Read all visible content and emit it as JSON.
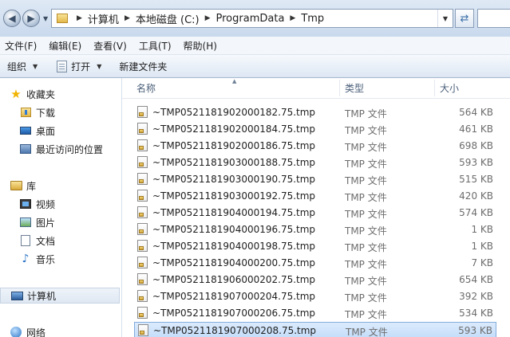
{
  "address": {
    "crumbs": [
      "计算机",
      "本地磁盘 (C:)",
      "ProgramData",
      "Tmp"
    ]
  },
  "menu": [
    "文件(F)",
    "编辑(E)",
    "查看(V)",
    "工具(T)",
    "帮助(H)"
  ],
  "commands": {
    "organize": "组织",
    "open": "打开",
    "new_folder": "新建文件夹"
  },
  "nav": {
    "favorites": "收藏夹",
    "downloads": "下载",
    "desktop": "桌面",
    "recent": "最近访问的位置",
    "libraries": "库",
    "videos": "视频",
    "pictures": "图片",
    "documents": "文档",
    "music": "音乐",
    "computer": "计算机",
    "network": "网络"
  },
  "columns": {
    "name": "名称",
    "type": "类型",
    "size": "大小"
  },
  "files": [
    {
      "name": "~TMP0521181902000182.75.tmp",
      "type": "TMP 文件",
      "size": "564 KB"
    },
    {
      "name": "~TMP0521181902000184.75.tmp",
      "type": "TMP 文件",
      "size": "461 KB"
    },
    {
      "name": "~TMP0521181902000186.75.tmp",
      "type": "TMP 文件",
      "size": "698 KB"
    },
    {
      "name": "~TMP0521181903000188.75.tmp",
      "type": "TMP 文件",
      "size": "593 KB"
    },
    {
      "name": "~TMP0521181903000190.75.tmp",
      "type": "TMP 文件",
      "size": "515 KB"
    },
    {
      "name": "~TMP0521181903000192.75.tmp",
      "type": "TMP 文件",
      "size": "420 KB"
    },
    {
      "name": "~TMP0521181904000194.75.tmp",
      "type": "TMP 文件",
      "size": "574 KB"
    },
    {
      "name": "~TMP0521181904000196.75.tmp",
      "type": "TMP 文件",
      "size": "1 KB"
    },
    {
      "name": "~TMP0521181904000198.75.tmp",
      "type": "TMP 文件",
      "size": "1 KB"
    },
    {
      "name": "~TMP0521181904000200.75.tmp",
      "type": "TMP 文件",
      "size": "7 KB"
    },
    {
      "name": "~TMP0521181906000202.75.tmp",
      "type": "TMP 文件",
      "size": "654 KB"
    },
    {
      "name": "~TMP0521181907000204.75.tmp",
      "type": "TMP 文件",
      "size": "392 KB"
    },
    {
      "name": "~TMP0521181907000206.75.tmp",
      "type": "TMP 文件",
      "size": "534 KB"
    },
    {
      "name": "~TMP0521181907000208.75.tmp",
      "type": "TMP 文件",
      "size": "593 KB"
    }
  ]
}
